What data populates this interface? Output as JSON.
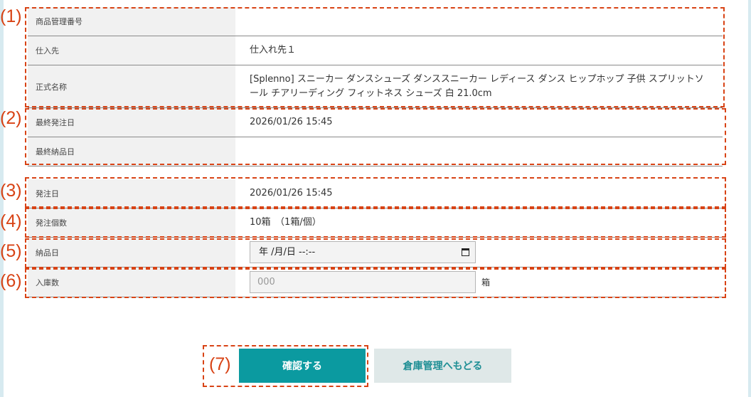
{
  "rows": {
    "product_no": {
      "label": "商品管理番号",
      "value": ""
    },
    "supplier": {
      "label": "仕入先",
      "value": "仕入れ先１"
    },
    "official_name": {
      "label": "正式名称",
      "value": "[Splenno] スニーカー ダンスシューズ ダンススニーカー レディース ダンス ヒップホップ 子供 スプリットソール チアリーディング フィットネス シューズ 白 21.0cm"
    },
    "last_order_date": {
      "label": "最終発注日",
      "value": "2026/01/26 15:45"
    },
    "last_delivery_date": {
      "label": "最終納品日",
      "value": ""
    },
    "order_date": {
      "label": "発注日",
      "value": "2026/01/26 15:45"
    },
    "order_qty": {
      "label": "発注個数",
      "value": "10箱　（1箱/個）"
    },
    "delivery_date": {
      "label": "納品日",
      "input_value": "年 /月/日 --:--"
    },
    "stock_in_qty": {
      "label": "入庫数",
      "placeholder": "000",
      "unit": "箱"
    }
  },
  "annotations": [
    "(1)",
    "(2)",
    "(3)",
    "(4)",
    "(5)",
    "(6)",
    "(7)"
  ],
  "buttons": {
    "confirm": "確認する",
    "back": "倉庫管理へもどる"
  },
  "colors": {
    "accent": "#0b9aa0",
    "annotation": "#d84315",
    "label_bg": "#f1f1f1"
  }
}
